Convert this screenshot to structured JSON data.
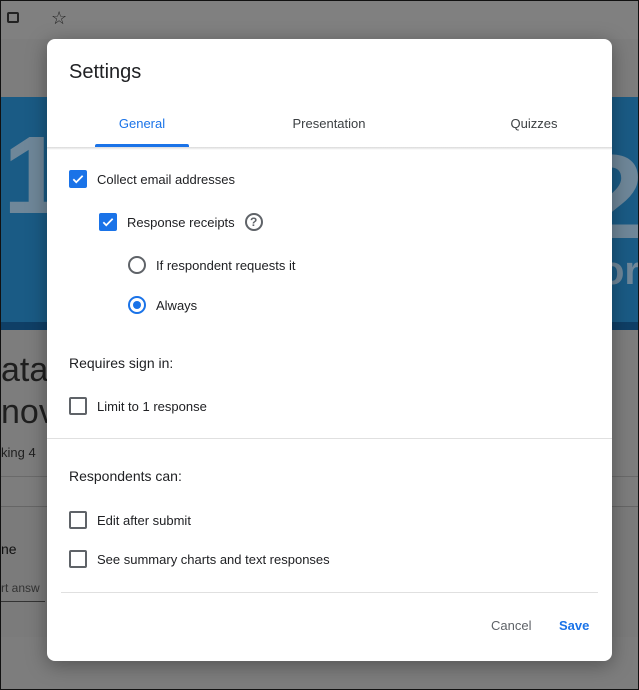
{
  "background": {
    "header_text_left": "1",
    "header_text_right": "2",
    "header_text_right_small": "or",
    "title_line1": "ata",
    "title_line2": "nov",
    "small_text": "king 4",
    "question_label": "ne",
    "answer_placeholder": "rt answ"
  },
  "dialog": {
    "title": "Settings",
    "tabs": [
      {
        "label": "General",
        "selected": true
      },
      {
        "label": "Presentation",
        "selected": false
      },
      {
        "label": "Quizzes",
        "selected": false
      }
    ],
    "options": {
      "collect_email": {
        "label": "Collect email addresses",
        "checked": true
      },
      "response_receipts": {
        "label": "Response receipts",
        "checked": true
      },
      "receipt_if_requested": {
        "label": "If respondent requests it",
        "selected": false
      },
      "receipt_always": {
        "label": "Always",
        "selected": true
      }
    },
    "requires_sign_in": {
      "heading": "Requires sign in:",
      "limit_one": {
        "label": "Limit to 1 response",
        "checked": false
      }
    },
    "respondents_can": {
      "heading": "Respondents can:",
      "edit_after_submit": {
        "label": "Edit after submit",
        "checked": false
      },
      "see_summary": {
        "label": "See summary charts and text responses",
        "checked": false
      }
    },
    "buttons": {
      "cancel": "Cancel",
      "save": "Save"
    }
  },
  "colors": {
    "accent": "#1a73e8",
    "text": "#202124",
    "secondary_text": "#5f6368",
    "scrim": "#7d7d7d"
  }
}
